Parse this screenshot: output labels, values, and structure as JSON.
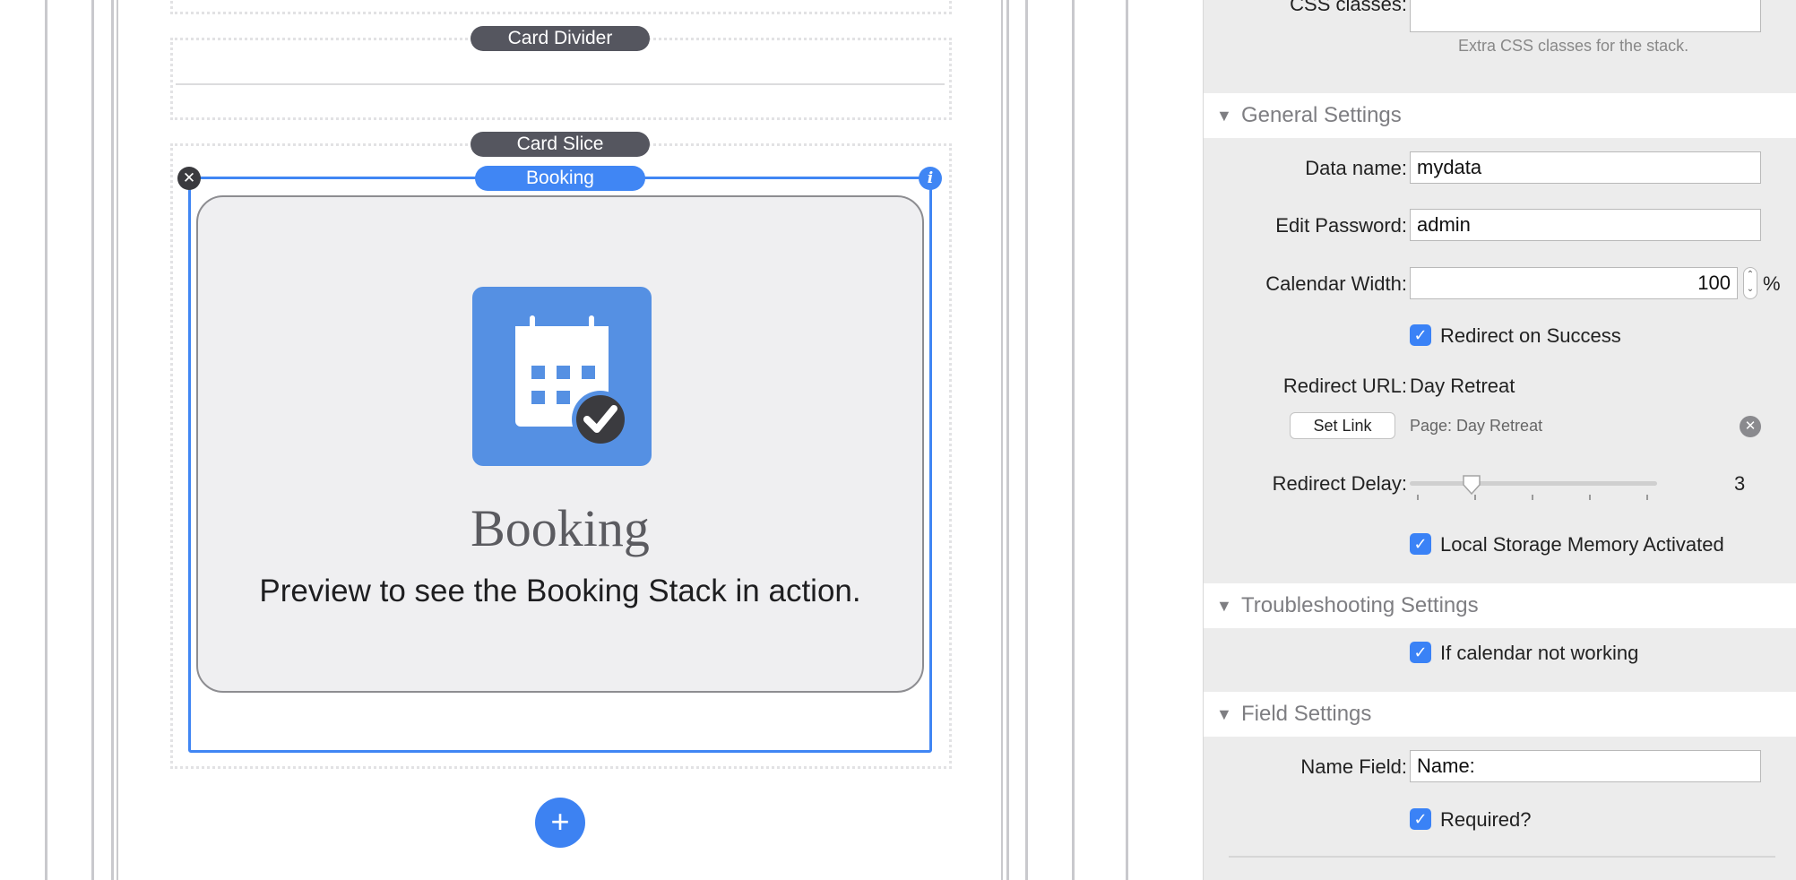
{
  "canvas": {
    "labels": {
      "card_divider": "Card Divider",
      "card_slice": "Card Slice",
      "booking_tag": "Booking"
    },
    "preview": {
      "title": "Booking",
      "subtitle": "Preview to see the Booking Stack in action."
    },
    "colors": {
      "accent": "#4086f4",
      "tag_dark": "#55565f",
      "icon_bg": "#5590e3"
    }
  },
  "inspector": {
    "css_classes": {
      "label": "CSS classes:",
      "value": "",
      "hint": "Extra CSS classes for the stack."
    },
    "general": {
      "header": "General Settings",
      "data_name": {
        "label": "Data name:",
        "value": "mydata"
      },
      "edit_password": {
        "label": "Edit Password:",
        "value": "admin"
      },
      "calendar_width": {
        "label": "Calendar Width:",
        "value": "100",
        "unit": "%"
      },
      "redirect_on_success": {
        "label": "Redirect on Success",
        "checked": true
      },
      "redirect_url": {
        "label": "Redirect URL:",
        "value": "Day Retreat"
      },
      "set_link": {
        "button": "Set Link",
        "page": "Page: Day Retreat"
      },
      "redirect_delay": {
        "label": "Redirect Delay:",
        "value": "3",
        "level": 0.25
      },
      "local_storage": {
        "label": "Local Storage Memory Activated",
        "checked": true
      }
    },
    "troubleshooting": {
      "header": "Troubleshooting Settings",
      "calendar_not_working": {
        "label": "If calendar not working",
        "checked": true
      }
    },
    "fields": {
      "header": "Field Settings",
      "name_field": {
        "label": "Name Field:",
        "value": "Name:"
      },
      "required": {
        "label": "Required?",
        "checked": true
      }
    }
  }
}
